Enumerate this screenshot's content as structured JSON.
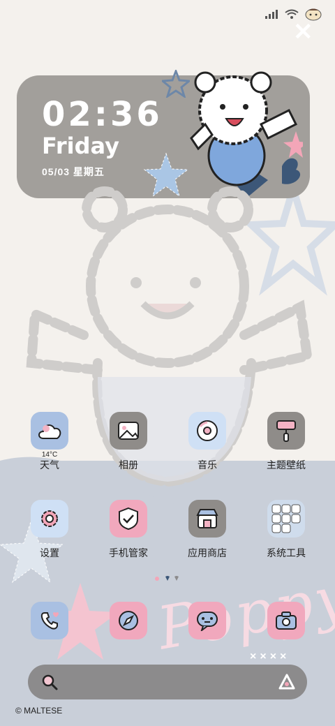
{
  "clock": {
    "time": "02:36",
    "day": "Friday",
    "date": "05/03 星期五"
  },
  "apps": [
    {
      "label": "天气",
      "icon": "cloud-icon",
      "temp": "14°C"
    },
    {
      "label": "相册",
      "icon": "image-icon"
    },
    {
      "label": "音乐",
      "icon": "disc-icon"
    },
    {
      "label": "主题壁纸",
      "icon": "paint-roller-icon"
    },
    {
      "label": "设置",
      "icon": "gear-icon"
    },
    {
      "label": "手机管家",
      "icon": "shield-check-icon"
    },
    {
      "label": "应用商店",
      "icon": "store-icon"
    },
    {
      "label": "系统工具",
      "icon": "folder-icon"
    }
  ],
  "dock": [
    {
      "icon": "phone-icon"
    },
    {
      "icon": "compass-icon"
    },
    {
      "icon": "message-icon"
    },
    {
      "icon": "camera-icon"
    }
  ],
  "decor": {
    "poppy": "Poppy",
    "credit": "© MALTESE",
    "xmarks": "××××"
  },
  "colors": {
    "card": "#a29f9b",
    "blue_tile": "#a9c0e2",
    "pink_tile": "#f1a8bd",
    "gray_tile": "#8f8c89",
    "search_bar": "#8c8b8c"
  }
}
